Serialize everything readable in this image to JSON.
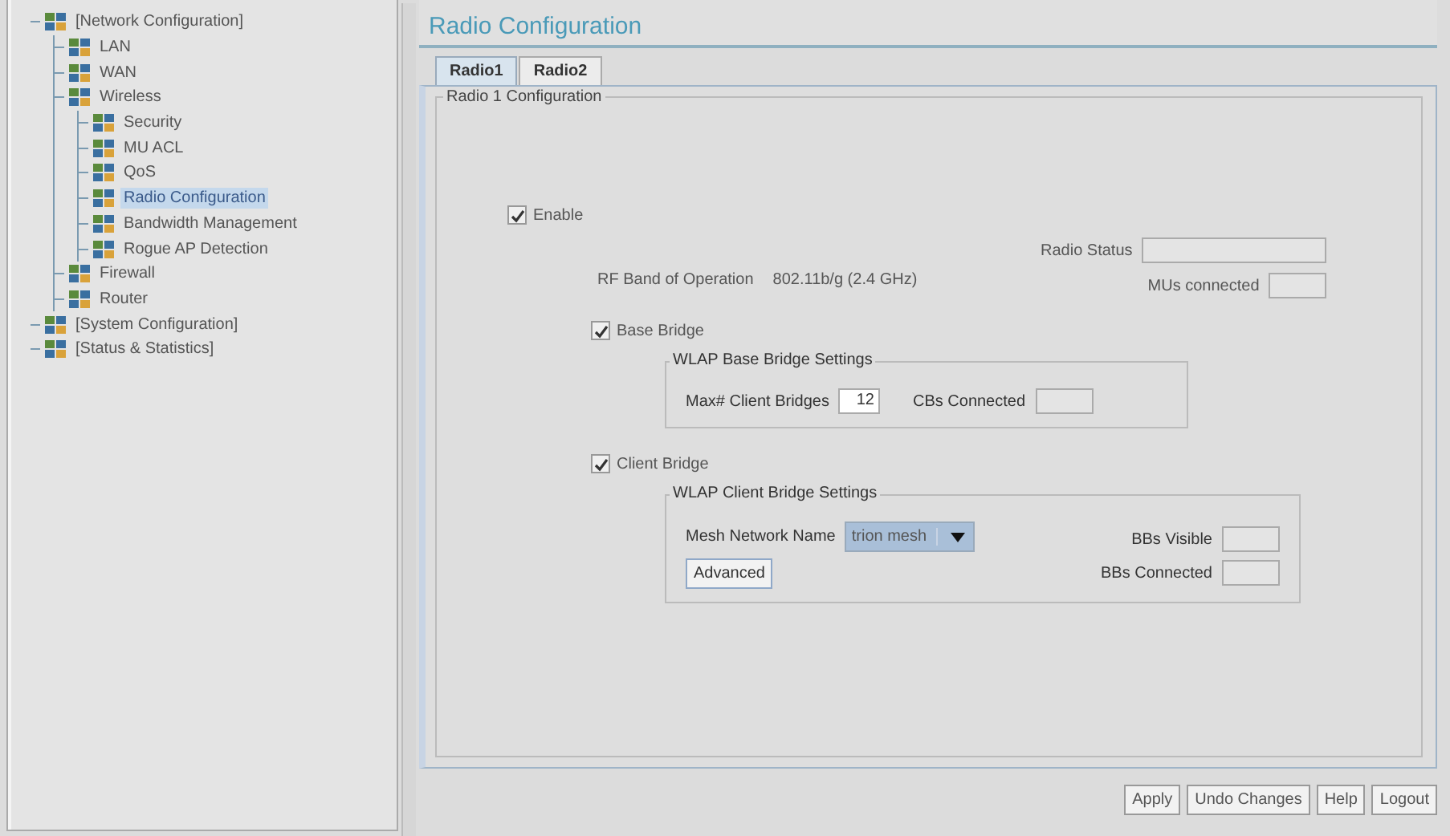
{
  "tree": [
    {
      "label": "[Network Configuration]",
      "selected": false,
      "children": [
        {
          "label": "LAN",
          "selected": false
        },
        {
          "label": "WAN",
          "selected": false
        },
        {
          "label": "Wireless",
          "selected": false,
          "children": [
            {
              "label": "Security",
              "selected": false
            },
            {
              "label": "MU ACL",
              "selected": false
            },
            {
              "label": "QoS",
              "selected": false
            },
            {
              "label": "Radio Configuration",
              "selected": true
            },
            {
              "label": "Bandwidth Management",
              "selected": false
            },
            {
              "label": "Rogue AP Detection",
              "selected": false
            }
          ]
        },
        {
          "label": "Firewall",
          "selected": false
        },
        {
          "label": "Router",
          "selected": false
        }
      ]
    },
    {
      "label": "[System Configuration]",
      "selected": false
    },
    {
      "label": "[Status & Statistics]",
      "selected": false
    }
  ],
  "page_title": "Radio Configuration",
  "tabs": [
    {
      "label": "Radio1",
      "selected": true
    },
    {
      "label": "Radio2",
      "selected": false
    }
  ],
  "panel_title": "Radio 1 Configuration",
  "enable": {
    "label": "Enable",
    "checked": true
  },
  "rf_band": {
    "label": "RF Band of Operation",
    "value": "802.11b/g (2.4 GHz)"
  },
  "radio_status": {
    "label": "Radio Status"
  },
  "mus_connected": {
    "label": "MUs connected"
  },
  "base_bridge": {
    "label": "Base Bridge",
    "checked": true
  },
  "base_group": {
    "title": "WLAP Base Bridge Settings",
    "max_label": "Max# Client Bridges",
    "max_value": "12",
    "cbs_label": "CBs Connected"
  },
  "client_bridge": {
    "label": "Client Bridge",
    "checked": true
  },
  "client_group": {
    "title": "WLAP Client Bridge Settings",
    "mesh_label": "Mesh Network Name",
    "mesh_value": "trion mesh",
    "advanced": "Advanced",
    "bbs_visible": "BBs Visible",
    "bbs_connected": "BBs Connected"
  },
  "buttons": [
    "Apply",
    "Undo Changes",
    "Help",
    "Logout"
  ]
}
